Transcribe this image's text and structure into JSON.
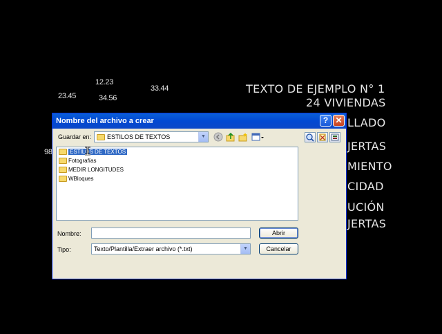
{
  "background": {
    "numbers": [
      {
        "text": "12.23"
      },
      {
        "text": "23.45"
      },
      {
        "text": "34.56"
      },
      {
        "text": "33.44"
      },
      {
        "text": "98"
      }
    ],
    "lines": [
      {
        "text": "TEXTO DE EJEMPLO N° 1"
      },
      {
        "text": "24 VIVIENDAS"
      },
      {
        "text": "LLADO"
      },
      {
        "text": "JERTAS"
      },
      {
        "text": "MIENTO"
      },
      {
        "text": "CIDAD"
      },
      {
        "text": "UCIÓN"
      },
      {
        "text": "JERTAS"
      }
    ]
  },
  "dialog": {
    "title": "Nombre del archivo a crear",
    "look_in_label": "Guardar en:",
    "look_in_value": "ESTILOS DE TEXTOS",
    "items": [
      {
        "label": "ESTILOS DE TEXTOS",
        "selected": true
      },
      {
        "label": "Fotografías"
      },
      {
        "label": "MEDIR LONGITUDES"
      },
      {
        "label": "WBloques"
      }
    ],
    "filename_label": "Nombre:",
    "filename_value": "",
    "type_label": "Tipo:",
    "type_value": "Texto/Plantilla/Extraer archivo (*.txt)",
    "open_button": "Abrir",
    "cancel_button": "Cancelar",
    "help_glyph": "?",
    "close_glyph": "✕"
  },
  "colors": {
    "titlebar": "#0a5fd8",
    "selection": "#316ac5",
    "dialog_bg": "#ece9d8"
  },
  "icons": [
    "folder-icon",
    "back-icon",
    "up-folder-icon",
    "new-folder-icon",
    "views-menu-icon",
    "search-web-icon",
    "delete-icon",
    "tools-icon"
  ]
}
